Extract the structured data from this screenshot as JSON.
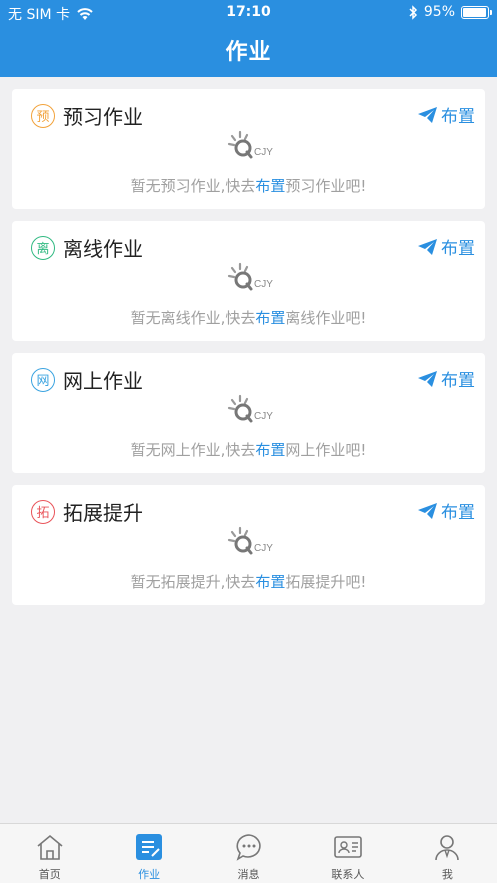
{
  "status_bar": {
    "carrier": "无 SIM 卡",
    "time": "17:10",
    "battery": "95%",
    "battery_level": 0.95
  },
  "header": {
    "title": "作业"
  },
  "sections": [
    {
      "badge": "预",
      "badge_color": "#f2a23a",
      "title": "预习作业",
      "assign_label": "布置",
      "empty_prefix": "暂无预习作业,快去",
      "empty_link": "布置",
      "empty_suffix": "预习作业吧!"
    },
    {
      "badge": "离",
      "badge_color": "#2fb981",
      "title": "离线作业",
      "assign_label": "布置",
      "empty_prefix": "暂无离线作业,快去",
      "empty_link": "布置",
      "empty_suffix": "离线作业吧!"
    },
    {
      "badge": "网",
      "badge_color": "#3aa3e0",
      "title": "网上作业",
      "assign_label": "布置",
      "empty_prefix": "暂无网上作业,快去",
      "empty_link": "布置",
      "empty_suffix": "网上作业吧!"
    },
    {
      "badge": "拓",
      "badge_color": "#e9545a",
      "title": "拓展提升",
      "assign_label": "布置",
      "empty_prefix": "暂无拓展提升,快去",
      "empty_link": "布置",
      "empty_suffix": "拓展提升吧!"
    }
  ],
  "logo_text": "CJY",
  "tabs": [
    {
      "label": "首页",
      "icon": "home-icon",
      "active": false
    },
    {
      "label": "作业",
      "icon": "homework-icon",
      "active": true
    },
    {
      "label": "消息",
      "icon": "message-icon",
      "active": false
    },
    {
      "label": "联系人",
      "icon": "contacts-icon",
      "active": false
    },
    {
      "label": "我",
      "icon": "profile-icon",
      "active": false
    }
  ],
  "colors": {
    "primary": "#2a8fe0",
    "background": "#f0f0f2",
    "muted_text": "#a0a0a0"
  }
}
